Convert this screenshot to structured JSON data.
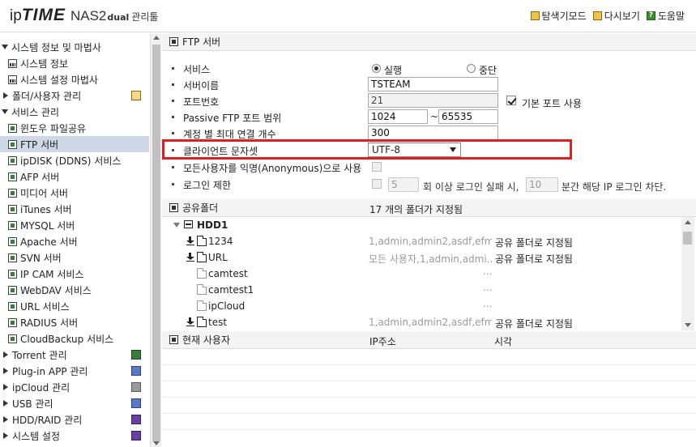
{
  "header": {
    "logo_ip": "ip",
    "logo_time": "TIME",
    "logo_model": "NAS2",
    "logo_dual": "dual",
    "logo_mgr": "관리툴",
    "links": [
      {
        "label": "탐색기모드",
        "icon": "explorer-icon"
      },
      {
        "label": "다시보기",
        "icon": "refresh-icon"
      },
      {
        "label": "도움말",
        "icon": "help-icon",
        "glyph": "?"
      }
    ]
  },
  "sidebar": {
    "system_info": "시스템 정보 및 마법사",
    "system_info_sub": [
      "시스템 정보",
      "시스템 설정 마법사"
    ],
    "folder_user": "폴더/사용자 관리",
    "service_mgmt": "서비스 관리",
    "services": [
      "윈도우 파일공유",
      "FTP 서버",
      "ipDISK (DDNS) 서비스",
      "AFP 서버",
      "미디어 서버",
      "iTunes 서버",
      "MYSQL 서버",
      "Apache 서버",
      "SVN 서버",
      "IP CAM 서비스",
      "WebDAV 서비스",
      "URL 서비스",
      "RADIUS 서버",
      "CloudBackup 서비스"
    ],
    "others": [
      "Torrent 관리",
      "Plug-in APP 관리",
      "ipCloud 관리",
      "USB 관리",
      "HDD/RAID 관리",
      "시스템 설정"
    ]
  },
  "ftp": {
    "section_title": "FTP 서버",
    "service_label": "서비스",
    "service_on": "실행",
    "service_off": "중단",
    "name_label": "서버이름",
    "name_value": "TSTEAM",
    "port_label": "포트번호",
    "port_value": "21",
    "default_port_label": "기본 포트 사용",
    "passive_label": "Passive FTP 포트 범위",
    "passive_from": "1024",
    "passive_sep": "~",
    "passive_to": "65535",
    "maxconn_label": "계정 별 최대 연결 개수",
    "maxconn_value": "300",
    "charset_label": "클라이언트 문자셋",
    "charset_value": "UTF-8",
    "anon_label": "모든사용자를 익명(Anonymous)으로 사용",
    "login_limit_label": "로그인 제한",
    "login_fail_value": "5",
    "login_fail_text": "회 이상 로그인 실패 시,",
    "block_minutes_value": "10",
    "block_text": "분간 해당 IP 로그인 차단."
  },
  "shares": {
    "section_title": "공유폴더",
    "count_text": "17 개의 폴더가 지정됨",
    "disk": "HDD1",
    "rows": [
      {
        "name": "1234",
        "users": "1,admin,admin2,asdf,efmn...",
        "status": "공유 폴더로 지정됨"
      },
      {
        "name": "URL",
        "users": "모든 사용자,1,admin,admi...",
        "status": "공유 폴더로 지정됨"
      },
      {
        "name": "camtest",
        "users": "",
        "dots": "...",
        "status": ""
      },
      {
        "name": "camtest1",
        "users": "",
        "dots": "...",
        "status": ""
      },
      {
        "name": "ipCloud",
        "users": "",
        "dots": "...",
        "status": ""
      },
      {
        "name": "test",
        "users": "1,admin,admin2,asdf,efmn...",
        "status": "공유 폴더로 지정됨"
      }
    ]
  },
  "users": {
    "col_user": "현재 사용자",
    "col_ip": "IP주소",
    "col_time": "시각"
  }
}
